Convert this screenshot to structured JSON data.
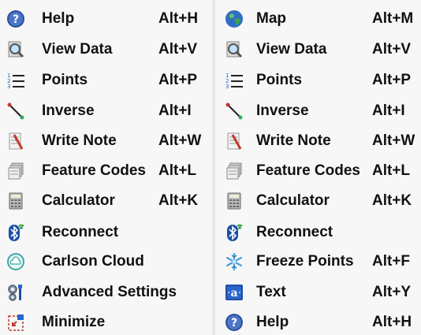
{
  "left_menu": [
    {
      "icon": "help-icon",
      "label": "Help",
      "shortcut": "Alt+H"
    },
    {
      "icon": "view-data-icon",
      "label": "View Data",
      "shortcut": "Alt+V"
    },
    {
      "icon": "points-icon",
      "label": "Points",
      "shortcut": "Alt+P"
    },
    {
      "icon": "inverse-icon",
      "label": "Inverse",
      "shortcut": "Alt+I"
    },
    {
      "icon": "write-note-icon",
      "label": "Write Note",
      "shortcut": "Alt+W"
    },
    {
      "icon": "feature-codes-icon",
      "label": "Feature Codes",
      "shortcut": "Alt+L"
    },
    {
      "icon": "calculator-icon",
      "label": "Calculator",
      "shortcut": "Alt+K"
    },
    {
      "icon": "bluetooth-icon",
      "label": "Reconnect",
      "shortcut": ""
    },
    {
      "icon": "cloud-icon",
      "label": "Carlson Cloud",
      "shortcut": ""
    },
    {
      "icon": "settings-icon",
      "label": "Advanced Settings",
      "shortcut": ""
    },
    {
      "icon": "minimize-icon",
      "label": "Minimize",
      "shortcut": ""
    }
  ],
  "right_menu": [
    {
      "icon": "globe-icon",
      "label": "Map",
      "shortcut": "Alt+M"
    },
    {
      "icon": "view-data-icon",
      "label": "View Data",
      "shortcut": "Alt+V"
    },
    {
      "icon": "points-icon",
      "label": "Points",
      "shortcut": "Alt+P"
    },
    {
      "icon": "inverse-icon",
      "label": "Inverse",
      "shortcut": "Alt+I"
    },
    {
      "icon": "write-note-icon",
      "label": "Write Note",
      "shortcut": "Alt+W"
    },
    {
      "icon": "feature-codes-icon",
      "label": "Feature Codes",
      "shortcut": "Alt+L"
    },
    {
      "icon": "calculator-icon",
      "label": "Calculator",
      "shortcut": "Alt+K"
    },
    {
      "icon": "bluetooth-icon",
      "label": "Reconnect",
      "shortcut": ""
    },
    {
      "icon": "freeze-icon",
      "label": "Freeze Points",
      "shortcut": "Alt+F"
    },
    {
      "icon": "text-icon",
      "label": "Text",
      "shortcut": "Alt+Y"
    },
    {
      "icon": "help-icon",
      "label": "Help",
      "shortcut": "Alt+H"
    }
  ]
}
